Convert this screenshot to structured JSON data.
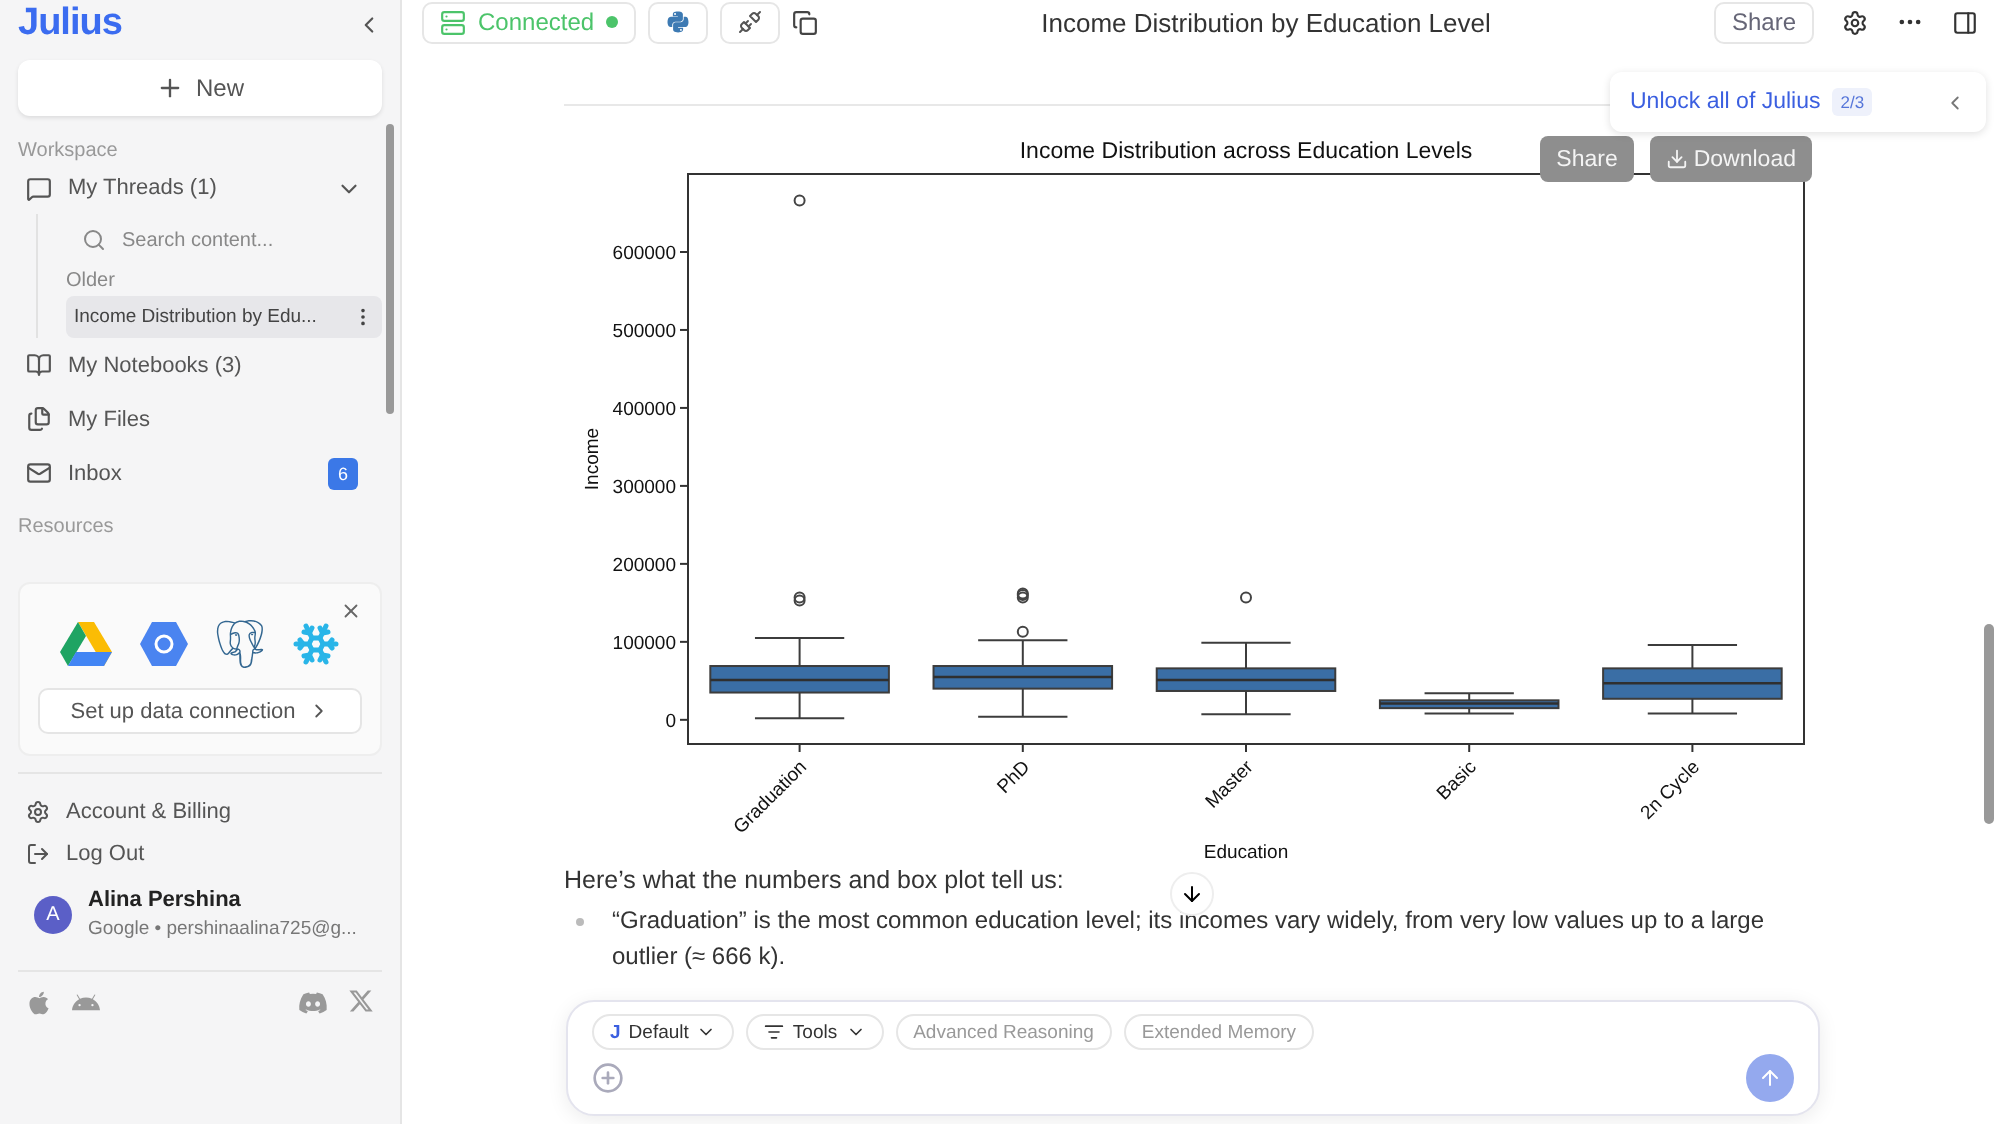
{
  "sidebar": {
    "logo": "Julius",
    "new_button": "New",
    "workspace_label": "Workspace",
    "threads": {
      "label": "My Threads (1)",
      "expanded": true,
      "search_placeholder": "Search content...",
      "group": "Older",
      "items": [
        {
          "title": "Income Distribution by Edu...",
          "selected": true
        }
      ]
    },
    "nav": [
      {
        "kind": "notebook",
        "label": "My Notebooks (3)"
      },
      {
        "kind": "files",
        "label": "My Files"
      },
      {
        "kind": "inbox",
        "label": "Inbox",
        "badge": "6"
      }
    ],
    "resources_label": "Resources",
    "connect_button": "Set up data connection",
    "account": [
      {
        "kind": "settings",
        "label": "Account & Billing"
      },
      {
        "kind": "logout",
        "label": "Log Out"
      }
    ],
    "user": {
      "initial": "A",
      "name": "Alina Pershina",
      "detail": "Google • pershinaalina725@g..."
    }
  },
  "header": {
    "status": {
      "label": "Connected",
      "on": true
    },
    "title": "Income Distribution by Education Level",
    "share": "Share"
  },
  "unlock": {
    "label": "Unlock all of Julius",
    "progress": "2/3"
  },
  "chart_buttons": [
    "Share",
    "Download"
  ],
  "chart": {
    "title": "Income Distribution across Education Levels",
    "xlabel": "Education",
    "ylabel": "Income",
    "categories": [
      "Graduation",
      "PhD",
      "Master",
      "Basic",
      "2n Cycle"
    ],
    "yticks": [
      "600000",
      "500000",
      "400000",
      "300000",
      "200000",
      "100000",
      "0"
    ]
  },
  "summary": {
    "intro": "Here’s what the numbers and box plot tell us:",
    "bullets": [
      "“Graduation” is the most common education level; its incomes vary widely, from very low values up to a large outlier (≈ 666 k)."
    ]
  },
  "composer": {
    "chips": [
      {
        "kind": "model",
        "mark": "J",
        "label": "Default",
        "on": true
      },
      {
        "kind": "tools",
        "label": "Tools",
        "on": true
      },
      {
        "kind": "toggle",
        "label": "Advanced Reasoning",
        "on": false
      },
      {
        "kind": "toggle",
        "label": "Extended Memory",
        "on": false
      }
    ]
  }
}
